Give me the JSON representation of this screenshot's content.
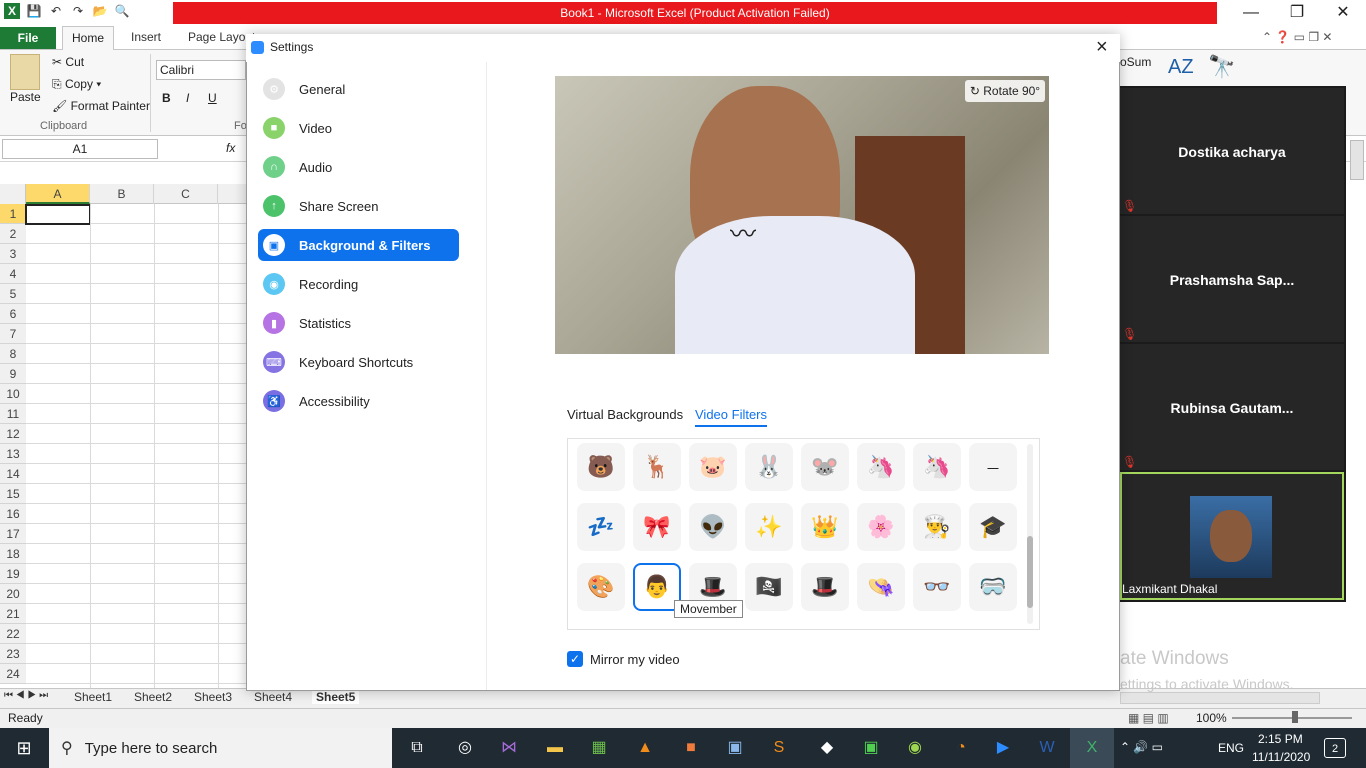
{
  "excel": {
    "window_title": "Book1 - Microsoft Excel (Product Activation Failed)",
    "tabs": [
      "File",
      "Home",
      "Insert",
      "Page Layout"
    ],
    "clipboard": {
      "paste": "Paste",
      "cut": "Cut",
      "copy": "Copy",
      "format_painter": "Format Painter",
      "group": "Clipboard"
    },
    "font_name": "Calibri",
    "font_buttons": [
      "B",
      "I",
      "U"
    ],
    "autosum": "oSum",
    "name_box": "A1",
    "fx": "fx",
    "columns": [
      "A",
      "B",
      "C"
    ],
    "rows": [
      "1",
      "2",
      "3",
      "4",
      "5",
      "6",
      "7",
      "8",
      "9",
      "10",
      "11",
      "12",
      "13",
      "14",
      "15",
      "16",
      "17",
      "18",
      "19",
      "20",
      "21",
      "22",
      "23",
      "24"
    ],
    "sheets": [
      "Sheet1",
      "Sheet2",
      "Sheet3",
      "Sheet4",
      "Sheet5"
    ],
    "status": "Ready",
    "zoom": "100%",
    "watermark_line1": "ate Windows",
    "watermark_line2": "ettings to activate Windows."
  },
  "zoom_panel": {
    "participants": [
      {
        "name": "Dostika acharya"
      },
      {
        "name": "Prashamsha  Sap..."
      },
      {
        "name": "Rubinsa  Gautam..."
      }
    ],
    "active_speaker": "Laxmikant Dhakal"
  },
  "settings": {
    "title": "Settings",
    "close": "×",
    "nav": [
      {
        "label": "General",
        "icon": "gear-icon",
        "color": "#e3e3e3",
        "glyph": "⚙"
      },
      {
        "label": "Video",
        "icon": "video-camera-icon",
        "color": "#8ad36b",
        "glyph": "■"
      },
      {
        "label": "Audio",
        "icon": "headphones-icon",
        "color": "#6fd08a",
        "glyph": "∩"
      },
      {
        "label": "Share Screen",
        "icon": "share-screen-icon",
        "color": "#4cc36b",
        "glyph": "↑"
      },
      {
        "label": "Background & Filters",
        "icon": "background-icon",
        "color": "#0e72ed",
        "glyph": "▣"
      },
      {
        "label": "Recording",
        "icon": "recording-icon",
        "color": "#5cc7f2",
        "glyph": "◉"
      },
      {
        "label": "Statistics",
        "icon": "statistics-icon",
        "color": "#b673e3",
        "glyph": "▮"
      },
      {
        "label": "Keyboard Shortcuts",
        "icon": "keyboard-icon",
        "color": "#8573e3",
        "glyph": "⌨"
      },
      {
        "label": "Accessibility",
        "icon": "accessibility-icon",
        "color": "#7a6ee3",
        "glyph": "♿"
      }
    ],
    "active_nav": "Background & Filters",
    "rotate": "Rotate 90°",
    "filter_tabs": [
      "Virtual Backgrounds",
      "Video Filters"
    ],
    "active_filter_tab": "Video Filters",
    "filters": [
      [
        "🐻",
        "🦌",
        "🐷",
        "🐰",
        "🐭",
        "🦄",
        "🦄",
        "⎯"
      ],
      [
        "💤",
        "🎀",
        "👽",
        "✨",
        "👑",
        "🌸",
        "👨‍🍳",
        "🎓"
      ],
      [
        "🎨",
        "👨",
        "🎩",
        "🏴‍☠️",
        "🎩",
        "👒",
        "👓",
        "🥽"
      ]
    ],
    "selected_filter": "Movember",
    "tooltip": "Movember",
    "mirror_label": "Mirror my video",
    "mirror_checked": true
  },
  "taskbar": {
    "search_placeholder": "Type here to search",
    "time": "2:15 PM",
    "date": "11/11/2020",
    "lang": "ENG",
    "notifications": "2"
  }
}
